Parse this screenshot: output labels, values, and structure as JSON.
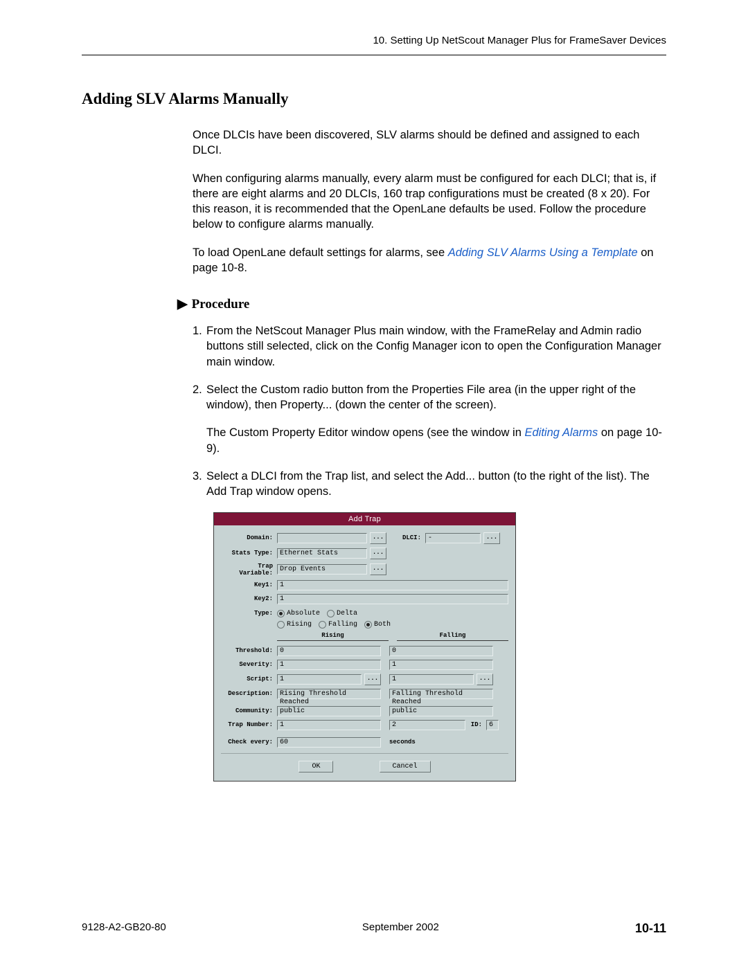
{
  "header": "10. Setting Up NetScout Manager Plus for FrameSaver Devices",
  "h1": "Adding SLV Alarms Manually",
  "p1": "Once DLCIs have been discovered, SLV alarms should be defined and assigned to each DLCI.",
  "p2": "When configuring alarms manually, every alarm must be configured for each DLCI; that is, if there are eight alarms and 20 DLCIs, 160 trap configurations must be created (8 x 20). For this reason, it is recommended that the OpenLane defaults be used. Follow the procedure below to configure alarms manually.",
  "p3a": "To load OpenLane default settings for alarms, see ",
  "p3link": "Adding SLV Alarms Using a Template",
  "p3b": " on page 10-8.",
  "proc": "Procedure",
  "s1n": "1.",
  "s1": "From the NetScout Manager Plus main window, with the FrameRelay and Admin radio buttons still selected, click on the Config Manager icon to open the Configuration Manager main window.",
  "s2n": "2.",
  "s2": "Select the Custom radio button from the Properties File area (in the upper right of the window), then Property... (down the center of the screen).",
  "s2ba": "The Custom Property Editor window opens (see the window in ",
  "s2blink": "Editing Alarms",
  "s2bb": " on page 10-9).",
  "s3n": "3.",
  "s3": "Select a DLCI from the Trap list, and select the Add... button (to the right of the list). The Add Trap window opens.",
  "win": {
    "title": "Add Trap",
    "domain_lbl": "Domain:",
    "domain_val": "",
    "dlci_lbl": "DLCI:",
    "dlci_val": "-",
    "stats_lbl": "Stats Type:",
    "stats_val": "Ethernet Stats",
    "trapvar_lbl": "Trap Variable:",
    "trapvar_val": "Drop Events",
    "key1_lbl": "Key1:",
    "key1_val": "1",
    "key2_lbl": "Key2:",
    "key2_val": "1",
    "type_lbl": "Type:",
    "type_abs": "Absolute",
    "type_delta": "Delta",
    "dir_rising": "Rising",
    "dir_falling": "Falling",
    "dir_both": "Both",
    "col_rising": "Rising",
    "col_falling": "Falling",
    "thresh_lbl": "Threshold:",
    "thresh_r": "0",
    "thresh_f": "0",
    "sev_lbl": "Severity:",
    "sev_r": "1",
    "sev_f": "1",
    "script_lbl": "Script:",
    "script_r": "1",
    "script_f": "1",
    "desc_lbl": "Description:",
    "desc_r": "Rising Threshold Reached",
    "desc_f": "Falling Threshold Reached",
    "comm_lbl": "Community:",
    "comm_r": "public",
    "comm_f": "public",
    "trapnum_lbl": "Trap Number:",
    "trapnum_r": "1",
    "trapnum_f": "2",
    "id_lbl": "ID:",
    "id_val": "6",
    "check_lbl": "Check every:",
    "check_val": "60",
    "check_unit": "seconds",
    "ok": "OK",
    "cancel": "Cancel",
    "ell": "..."
  },
  "foot_l": "9128-A2-GB20-80",
  "foot_c": "September 2002",
  "foot_r": "10-11"
}
